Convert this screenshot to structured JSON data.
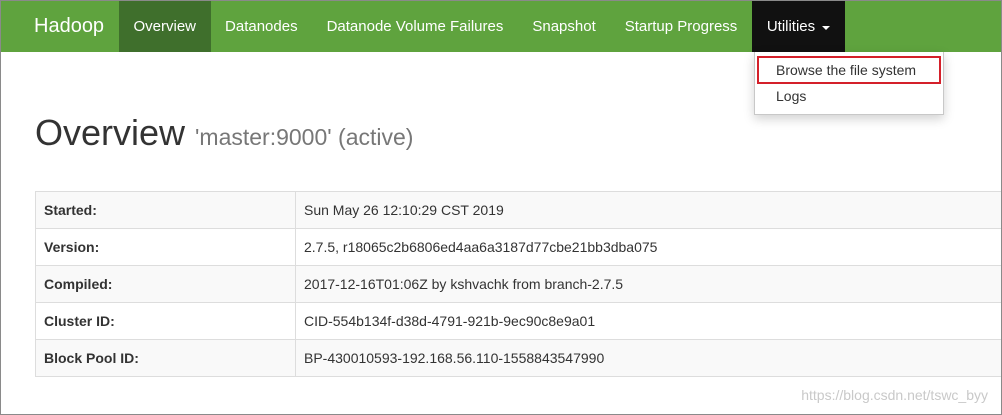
{
  "navbar": {
    "brand": "Hadoop",
    "items": [
      {
        "label": "Overview",
        "active": true
      },
      {
        "label": "Datanodes"
      },
      {
        "label": "Datanode Volume Failures"
      },
      {
        "label": "Snapshot"
      },
      {
        "label": "Startup Progress"
      }
    ],
    "utilities_label": "Utilities",
    "colors": {
      "bar": "#5fa33e",
      "active": "#3f6f2c",
      "open_dropdown": "#111111",
      "highlight_border": "#d4202a"
    }
  },
  "dropdown": {
    "items": [
      {
        "label": "Browse the file system",
        "highlighted": true
      },
      {
        "label": "Logs"
      }
    ]
  },
  "page": {
    "title": "Overview",
    "subtitle": "'master:9000' (active)"
  },
  "table": {
    "rows": [
      {
        "key": "Started:",
        "value": "Sun May 26 12:10:29 CST 2019"
      },
      {
        "key": "Version:",
        "value": "2.7.5, r18065c2b6806ed4aa6a3187d77cbe21bb3dba075"
      },
      {
        "key": "Compiled:",
        "value": "2017-12-16T01:06Z by kshvachk from branch-2.7.5"
      },
      {
        "key": "Cluster ID:",
        "value": "CID-554b134f-d38d-4791-921b-9ec90c8e9a01"
      },
      {
        "key": "Block Pool ID:",
        "value": "BP-430010593-192.168.56.110-1558843547990"
      }
    ]
  },
  "watermark": "https://blog.csdn.net/tswc_byy"
}
